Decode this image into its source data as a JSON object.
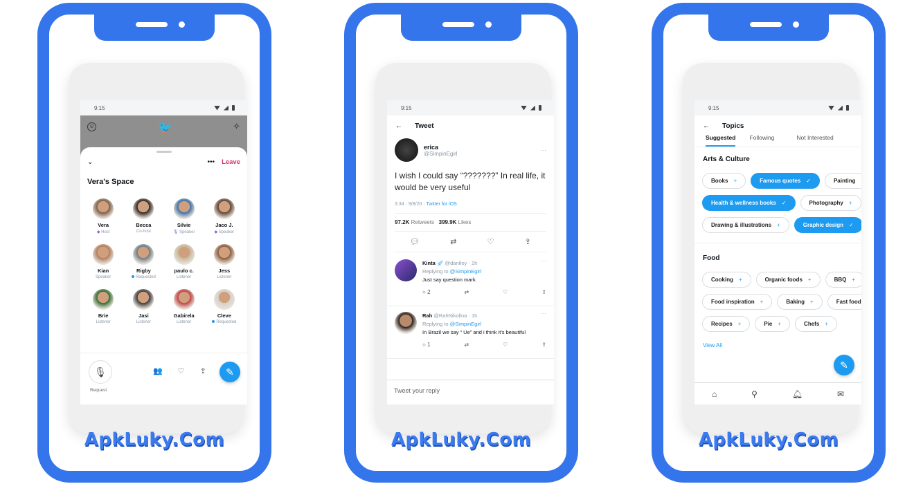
{
  "watermark": "ApkLuky.Com",
  "status_time": "9:15",
  "phone1": {
    "title": "Vera's Space",
    "leave_label": "Leave",
    "more_label": "•••",
    "request_label": "Request",
    "participants": [
      {
        "name": "Vera",
        "role": "Host"
      },
      {
        "name": "Becca",
        "role": "Co-host"
      },
      {
        "name": "Silvie",
        "role": "Speaker"
      },
      {
        "name": "Jaco J.",
        "role": "Speaker"
      },
      {
        "name": "Kian",
        "role": "Speaker"
      },
      {
        "name": "Rigby",
        "role": "Requested"
      },
      {
        "name": "paulo c.",
        "role": "Listener"
      },
      {
        "name": "Jess",
        "role": "Listener"
      },
      {
        "name": "Brie",
        "role": "Listener"
      },
      {
        "name": "Jasi",
        "role": "Listener"
      },
      {
        "name": "Gabirela",
        "role": "Listener"
      },
      {
        "name": "Cleve",
        "role": "Requested"
      }
    ]
  },
  "phone2": {
    "header": "Tweet",
    "tweet": {
      "name": "erica",
      "handle": "@SimpinEgirl",
      "text": "I wish I could say “???????” In real life, it would be very useful",
      "time": "3:34 · 9/8/20 · ",
      "source": "Twitter for iOS",
      "retweets": "97.2K",
      "retweets_label": "Retweets",
      "likes": "399.9K",
      "likes_label": "Likes"
    },
    "replies": [
      {
        "name": "Kinta",
        "handle": "@dantley · 1h",
        "replying_to": "Replying to ",
        "mention": "@SimpinEgirl",
        "text": "Just say question mark",
        "reply_count": "2"
      },
      {
        "name": "Rah",
        "handle": "@RahNikolina · 1h",
        "replying_to": "Replying to ",
        "mention": "@SimpinEgirl",
        "text": "In Brazil we say “ Ue” and i think it's beautiful",
        "reply_count": "1"
      }
    ],
    "reply_placeholder": "Tweet your reply"
  },
  "phone3": {
    "header": "Topics",
    "tabs": [
      "Suggested",
      "Following",
      "Not Interested"
    ],
    "sections": [
      {
        "title": "Arts & Culture",
        "rows": [
          [
            {
              "label": "Books",
              "selected": false
            },
            {
              "label": "Famous quotes",
              "selected": true
            },
            {
              "label": "Painting",
              "selected": false
            }
          ],
          [
            {
              "label": "Health & wellness books",
              "selected": true
            },
            {
              "label": "Photography",
              "selected": false
            }
          ],
          [
            {
              "label": "Drawing & illustrations",
              "selected": false
            },
            {
              "label": "Graphic design",
              "selected": true
            }
          ]
        ]
      },
      {
        "title": "Food",
        "rows": [
          [
            {
              "label": "Cooking",
              "selected": false
            },
            {
              "label": "Organic foods",
              "selected": false
            },
            {
              "label": "BBQ",
              "selected": false
            }
          ],
          [
            {
              "label": "Food inspiration",
              "selected": false
            },
            {
              "label": "Baking",
              "selected": false
            },
            {
              "label": "Fast food",
              "selected": false
            }
          ],
          [
            {
              "label": "Recipes",
              "selected": false
            },
            {
              "label": "Pie",
              "selected": false
            },
            {
              "label": "Chefs",
              "selected": false
            }
          ]
        ]
      }
    ],
    "view_all": "View All",
    "nav": [
      "home-icon",
      "search-icon",
      "notifications-icon",
      "messages-icon"
    ]
  },
  "colors": {
    "frame": "#3475ec",
    "accent": "#1d9bf0",
    "leave": "#d6336c"
  }
}
